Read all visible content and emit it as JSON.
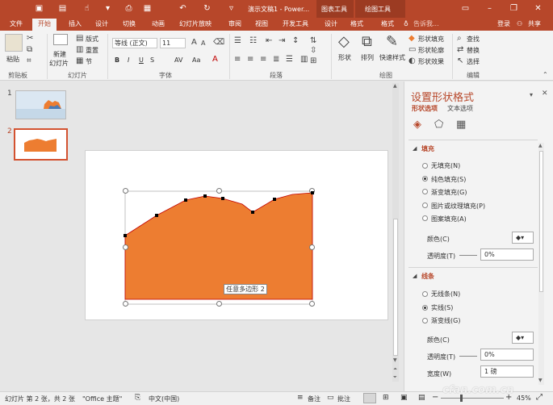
{
  "titlebar": {
    "doc_title": "演示文稿1 - Power...",
    "context_group_chart": "图表工具",
    "context_group_draw": "绘图工具",
    "login": "登录",
    "share": "共享",
    "tell_me": "告诉我..."
  },
  "tabs": [
    "文件",
    "开始",
    "插入",
    "设计",
    "切换",
    "动画",
    "幻灯片放映",
    "审阅",
    "视图",
    "开发工具",
    "设计",
    "格式",
    "格式"
  ],
  "active_tab_index": 1,
  "ribbon": {
    "clipboard": {
      "paste": "粘贴",
      "label": "剪贴板"
    },
    "slides": {
      "new_slide_1": "新建",
      "new_slide_2": "幻灯片",
      "layout": "版式",
      "reset": "重置",
      "section": "节",
      "label": "幻灯片"
    },
    "font": {
      "font_name": "等线 (正文)",
      "font_size": "11",
      "label": "字体",
      "bold": "B",
      "italic": "I",
      "underline": "U",
      "strike": "S",
      "spacing": "AV",
      "case": "Aa",
      "font_color": "A"
    },
    "paragraph": {
      "label": "段落"
    },
    "drawing": {
      "shapes": "形状",
      "arrange": "排列",
      "quick_styles": "快速样式",
      "fill": "形状填充",
      "outline": "形状轮廓",
      "effects": "形状效果",
      "label": "绘图"
    },
    "editing": {
      "find": "查找",
      "replace": "替换",
      "select": "选择",
      "label": "编辑"
    }
  },
  "thumbnails": [
    {
      "number": "1"
    },
    {
      "number": "2"
    }
  ],
  "selected_slide": 2,
  "slide": {
    "tooltip": "任意多边形 2",
    "shape_fill": "#ed7d31",
    "outline": "#c00000"
  },
  "panel": {
    "title": "设置形状格式",
    "tab_shape": "形状选项",
    "tab_text": "文本选项",
    "fill_header": "填充",
    "fill_options": [
      "无填充(N)",
      "纯色填充(S)",
      "渐变填充(G)",
      "图片或纹理填充(P)",
      "图案填充(A)"
    ],
    "fill_selected": 1,
    "color_label": "颜色(C)",
    "transparency_label": "透明度(T)",
    "fill_transparency": "0%",
    "line_header": "线条",
    "line_options": [
      "无线条(N)",
      "实线(S)",
      "渐变线(G)"
    ],
    "line_selected": 1,
    "line_color_label": "颜色(C)",
    "line_transparency_label": "透明度(T)",
    "line_transparency": "0%",
    "width_label": "宽度(W)",
    "width_value": "1 磅"
  },
  "status": {
    "slide_info": "幻灯片 第 2 张，共 2 张",
    "theme": "\"Office 主题\"",
    "language": "中文(中国)",
    "notes": "备注",
    "comments": "批注",
    "zoom": "45%"
  },
  "watermark": "cfan.com.cn"
}
